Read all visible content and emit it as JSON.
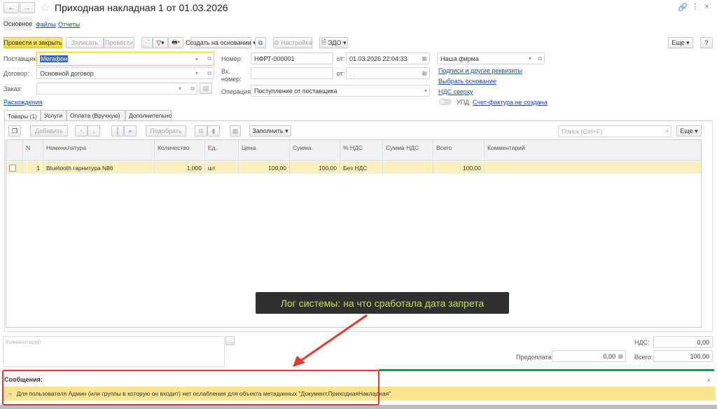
{
  "window": {
    "title": "Приходная накладная 1 от 01.03.2026",
    "back": "←",
    "forward": "→"
  },
  "nav_tabs": [
    "Основное",
    "Файлы",
    "Отчеты"
  ],
  "toolbar": {
    "post_close": "Провести и закрыть",
    "save": "Записать",
    "post": "Провести",
    "create_based": "Создать на основании",
    "settings": "Настройка",
    "edo": "ЭДО",
    "more": "Еще",
    "help": "?"
  },
  "form": {
    "supplier_label": "Поставщик:",
    "supplier": "Мегафон",
    "contract_label": "Договор:",
    "contract": "Основной договор",
    "order_label": "Заказ:",
    "order": "",
    "discrepancies": "Расхождения",
    "number_label": "Номер:",
    "number": "НФРТ-000001",
    "date_label": "от:",
    "date": "01.03.2026 22:04:33",
    "in_number_label": "Вх. номер:",
    "in_number": "",
    "in_date_label": "от:",
    "in_date": " .  .",
    "operation_label": "Операция:",
    "operation": "Поступление от поставщика",
    "company": "Наша фирма",
    "links": [
      "Подписи и другие реквизиты",
      "Выбрать основание",
      "НДС сверху"
    ],
    "upd_label": "УПД",
    "invoice_link": "Счет-фактура не создана"
  },
  "doc_tabs": [
    "Товары (1)",
    "Услуги",
    "Оплата (Вручную)",
    "Дополнительно"
  ],
  "table_toolbar": {
    "add": "Добавить",
    "pick": "Подобрать",
    "fill": "Заполнить",
    "search_placeholder": "Поиск (Ctrl+F)",
    "more": "Еще"
  },
  "table": {
    "columns": [
      "N",
      "Номенклатура",
      "Количество",
      "Ед.",
      "Цена",
      "Сумма",
      "% НДС",
      "Сумма НДС",
      "Всего",
      "Комментарий"
    ],
    "rows": [
      [
        "1",
        "Bluetooth гарнитура N86",
        "1,000",
        "шт",
        "100,00",
        "100,00",
        "Без НДС",
        "",
        "100,00",
        ""
      ]
    ]
  },
  "footer": {
    "comment_placeholder": "Комментарий",
    "vat_label": "НДС:",
    "vat": "0,00",
    "prepay_label": "Предоплата:",
    "prepay": "0,00",
    "total_label": "Всего:",
    "total": "100,00"
  },
  "annotation": "Лог системы: на что сработала дата запрета",
  "messages": {
    "title": "Сообщения:",
    "close": "x",
    "items": [
      "Для пользователя Админ (или группы в которую он входит) нет ослабления для объекта метаданных \"Документ.ПриходнаяНакладная\""
    ]
  },
  "colors": {
    "accent_yellow": "#f5dd5a",
    "highlight_row": "#fbf0c0",
    "link": "#1c4fa8",
    "annotation_bg": "#2f3030",
    "annotation_text": "#c8e04a",
    "arrow": "#e03a2e",
    "green_line": "#1a9a48"
  }
}
